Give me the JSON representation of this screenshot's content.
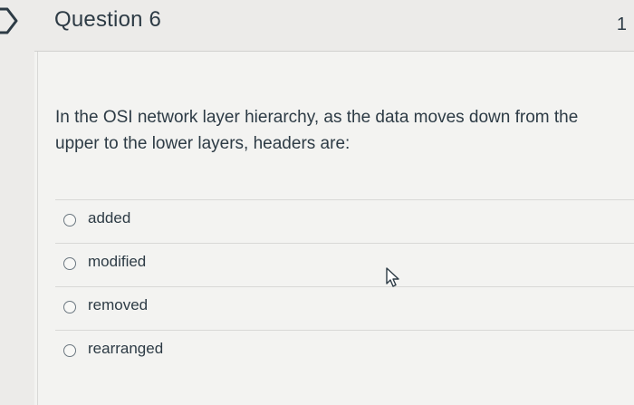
{
  "question": {
    "title": "Question 6",
    "points": "1",
    "text": "In the OSI network layer hierarchy, as the data moves down from the upper to the lower layers, headers are:",
    "answers": [
      {
        "label": "added"
      },
      {
        "label": "modified"
      },
      {
        "label": "removed"
      },
      {
        "label": "rearranged"
      }
    ]
  },
  "icons": {
    "flag": "flag-icon",
    "cursor": "mouse-pointer-icon",
    "radio": "radio-button-icon"
  },
  "colors": {
    "text": "#2d3b45",
    "header_bg": "#ecebe9",
    "body_bg": "#f3f3f1",
    "divider": "#d9d9d7"
  }
}
